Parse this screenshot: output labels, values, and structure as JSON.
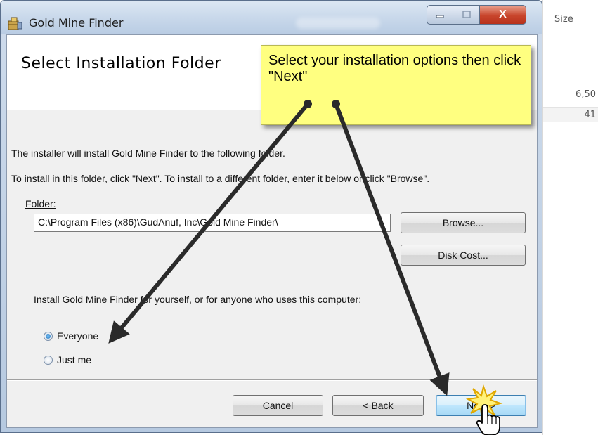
{
  "background_explorer": {
    "column_header": "Size",
    "rows": [
      "6,50",
      "41"
    ]
  },
  "window": {
    "title": "Gold Mine Finder",
    "close_glyph": "X"
  },
  "banner": {
    "title": "Select Installation Folder"
  },
  "callout": {
    "text": "Select your installation options then click \"Next\""
  },
  "content": {
    "intro_line": "The installer will install Gold Mine Finder to the following folder.",
    "instruction_line": "To install in this folder, click \"Next\". To install to a different folder, enter it below or click \"Browse\".",
    "folder_label": "Folder:",
    "folder_value": "C:\\Program Files (x86)\\GudAnuf, Inc\\Gold Mine Finder\\",
    "install_for_label": "Install Gold Mine Finder for yourself, or for anyone who uses this computer:",
    "options": [
      {
        "label": "Everyone",
        "selected": true
      },
      {
        "label": "Just me",
        "selected": false
      }
    ]
  },
  "buttons": {
    "browse": "Browse...",
    "disk_cost": "Disk Cost...",
    "cancel": "Cancel",
    "back": "< Back",
    "next": "Next >"
  },
  "icons": [
    "installer-app-icon",
    "minimize-icon",
    "maximize-icon",
    "close-icon",
    "hand-cursor-icon",
    "click-burst-icon",
    "arrow-icon"
  ],
  "colors": {
    "callout_bg": "#ffff80",
    "close_button": "#c8452c",
    "next_button_border": "#3c7fb1",
    "arrow": "#2a2a2a"
  }
}
